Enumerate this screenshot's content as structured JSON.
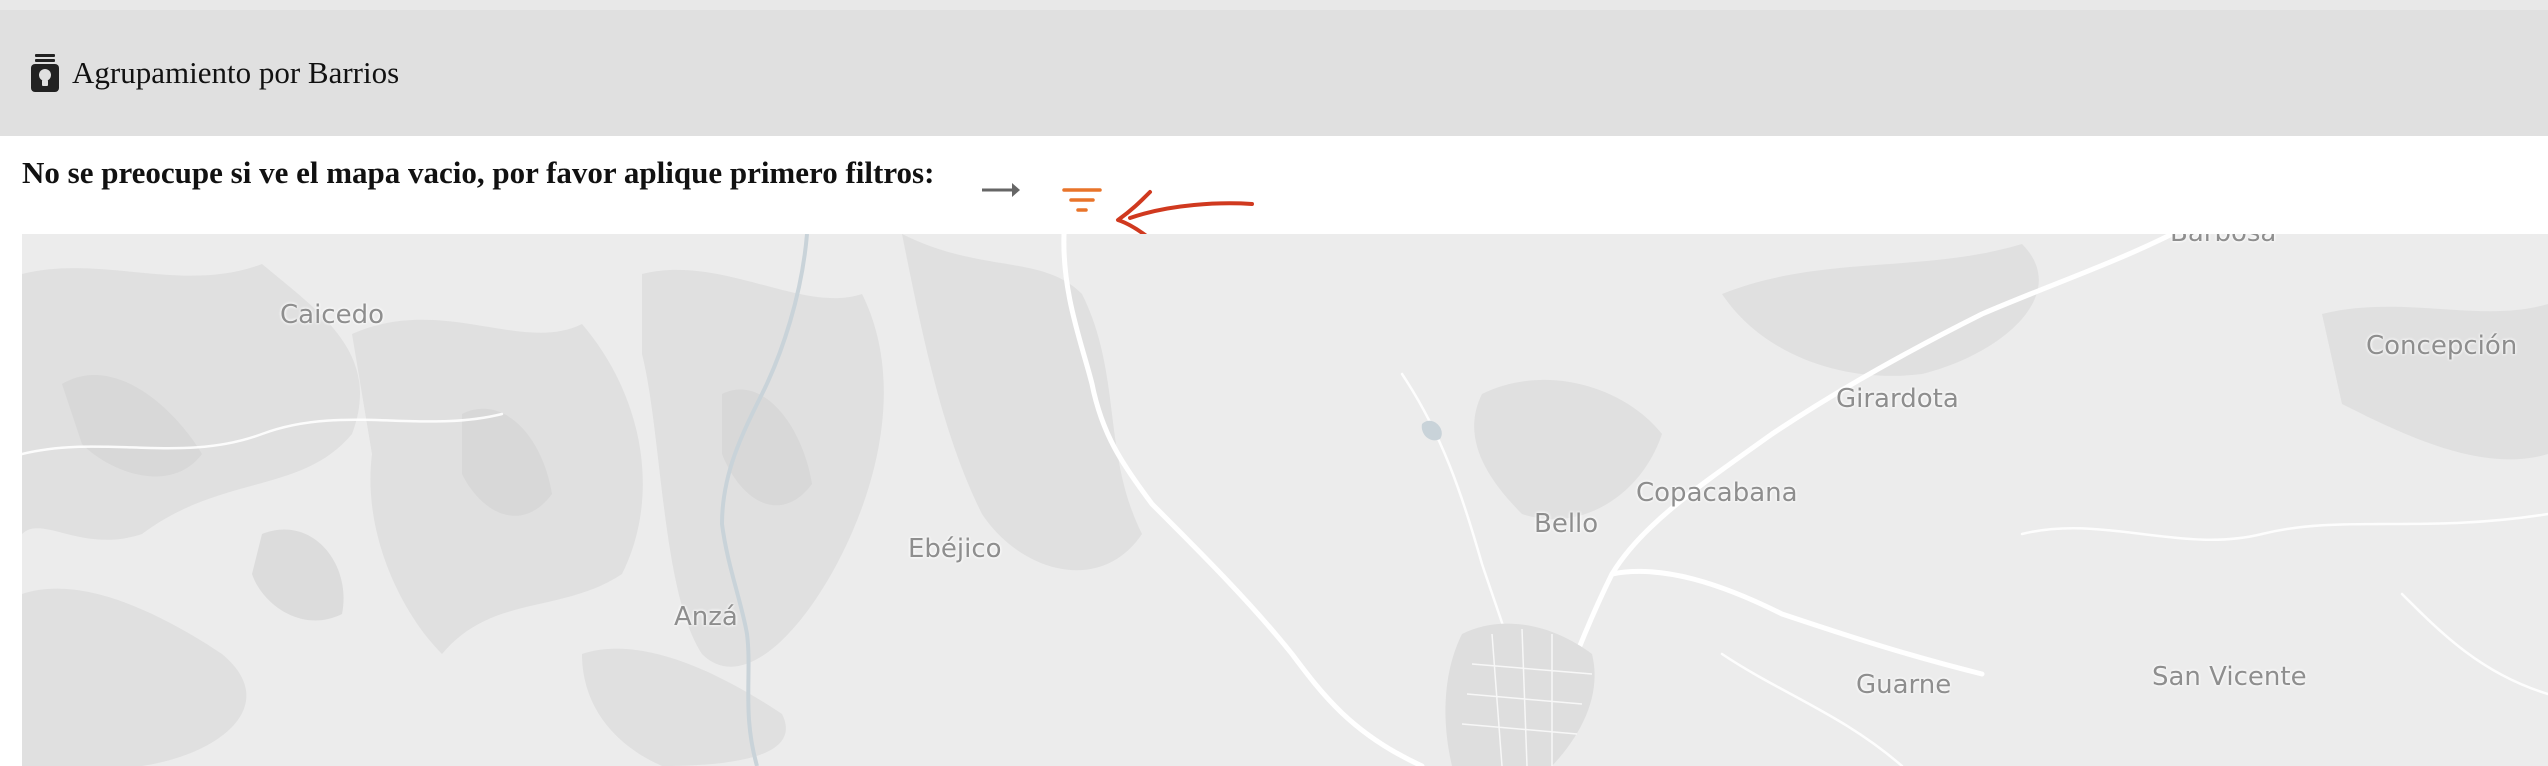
{
  "header": {
    "title": "Agrupamiento por Barrios",
    "icon": "tablet-lightbulb-icon"
  },
  "notice": {
    "text": "No se preocupe si ve el mapa vacio, por favor aplique primero filtros:",
    "arrow_icon": "right-arrow-icon",
    "filter_icon": "filter-icon",
    "filter_color": "#e8742a",
    "annotation_color": "#d0391f"
  },
  "map": {
    "places": [
      {
        "name": "Caicedo"
      },
      {
        "name": "Concepción"
      },
      {
        "name": "Girardota"
      },
      {
        "name": "Copacabana"
      },
      {
        "name": "Bello"
      },
      {
        "name": "Ebéjico"
      },
      {
        "name": "Anzá"
      },
      {
        "name": "Guarne"
      },
      {
        "name": "San Vicente"
      },
      {
        "name": "Barbosa"
      }
    ]
  }
}
